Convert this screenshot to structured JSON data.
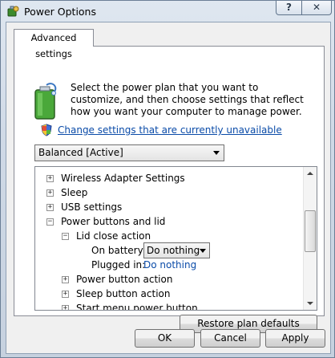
{
  "window": {
    "title": "Power Options",
    "help_label": "?",
    "close_label": "✕"
  },
  "tab": {
    "label": "Advanced settings"
  },
  "description": "Select the power plan that you want to customize, and then choose settings that reflect how you want your computer to manage power.",
  "change_link": "Change settings that are currently unavailable",
  "plan": {
    "selected": "Balanced [Active]"
  },
  "tree": {
    "items": [
      {
        "label": "Wireless Adapter Settings",
        "expander": "+"
      },
      {
        "label": "Sleep",
        "expander": "+"
      },
      {
        "label": "USB settings",
        "expander": "+"
      },
      {
        "label": "Power buttons and lid",
        "expander": "−"
      },
      {
        "label": "Lid close action",
        "expander": "−"
      },
      {
        "label": "On battery:",
        "value": "Do nothing"
      },
      {
        "label": "Plugged in:",
        "value": "Do nothing"
      },
      {
        "label": "Power button action",
        "expander": "+"
      },
      {
        "label": "Sleep button action",
        "expander": "+"
      },
      {
        "label": "Start menu power button",
        "expander": "+"
      }
    ]
  },
  "buttons": {
    "restore": "Restore plan defaults",
    "ok": "OK",
    "cancel": "Cancel",
    "apply": "Apply"
  }
}
